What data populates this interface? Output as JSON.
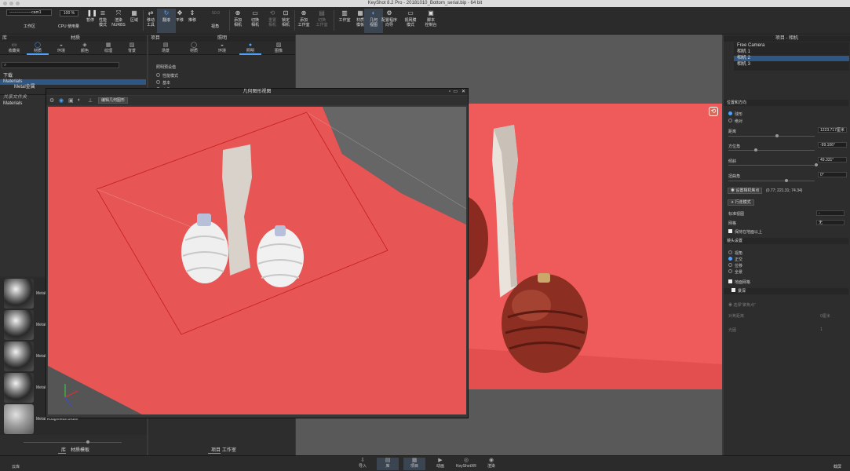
{
  "window": {
    "title": "KeyShot 8.2 Pro  -  20181010_Bottom_serial.bip  -  64 bit"
  },
  "toolbar": {
    "camera_select": "-----------------cam1",
    "workspace": "工作区",
    "cpu_value": "100 %",
    "cpu_label": "CPU 使用量",
    "pause": "暂停",
    "perf_mode": "性能\n模式",
    "render_nurbs": "渲染\nNURBS",
    "region": "区域",
    "move_tool": "移动\n工具",
    "tumble": "翻滚",
    "pan": "平移",
    "dolly": "推移",
    "fov_value": "50.0",
    "view_angle": "视角",
    "add_camera": "添加\n相机",
    "switch_camera": "切换\n相机",
    "reset_camera": "重置\n相机",
    "lock_camera": "锁定\n相机",
    "add_studio": "添加\n工作室",
    "switch_studio": "切换\n工作室",
    "studio": "工作室",
    "material_template": "材质\n模板",
    "geometry_view": "几何\n视图",
    "config_wizard": "配置程序\n向导",
    "viewset_mode": "视网膜\n模式",
    "script_console": "脚本\n控制台"
  },
  "left_panel": {
    "header_lib": "库",
    "header_materials": "材质",
    "tabs": [
      "收藏夹",
      "材质",
      "环境",
      "颜色",
      "纹理",
      "背景"
    ],
    "tree": [
      "下载",
      "Materials",
      "Metal金属"
    ],
    "shared_folder": "共享文件夹",
    "shared_tree": [
      "Materials"
    ],
    "thumb_labels": [
      "Metal",
      "Metal",
      "Metal",
      "Metal",
      "Metal Roughness Brush"
    ],
    "bottom_tabs": [
      "库",
      "材质模板"
    ]
  },
  "project_panel": {
    "header_project": "项目",
    "header_lighting": "照明",
    "tabs": [
      "场景",
      "材质",
      "环境",
      "照明",
      "图像"
    ],
    "preset_title": "照明预设值",
    "presets": [
      "性能模式",
      "基本",
      "产品"
    ],
    "bottom_tabs": [
      "项目",
      "工作室"
    ]
  },
  "geometry_dialog": {
    "title": "几何图形视图",
    "edit_button": "编辑几何图形"
  },
  "right_panel": {
    "header": "项目 - 相机",
    "cameras": [
      "Free Camera",
      "相机 1",
      "相机 2",
      "相机 3"
    ],
    "section_position": "位置和方向",
    "mode_options": [
      "球形",
      "绝对"
    ],
    "distance_label": "距离",
    "distance_value": "1223.717厘米",
    "azimuth_label": "方位角",
    "azimuth_value": "-99.106°",
    "inclination_label": "倾斜",
    "inclination_value": "49.331°",
    "twist_label": "扭曲角",
    "twist_value": "0°",
    "focus_button": "设置相机焦点",
    "focus_coords": "(0.77; 221.31; 74.34)",
    "walk_button": "行走模式",
    "std_view_label": "标准视图",
    "std_view_value": "-",
    "grid_label": "网格",
    "grid_value": "无",
    "keep_above": "保持在地面以上",
    "section_lens": "镜头设置",
    "lens_options": [
      "视角",
      "正交",
      "位移",
      "全景"
    ],
    "ground_grid": "地面网格",
    "section_dof": "景深",
    "select_focus": "选择\"聚焦点\"",
    "focus_distance_label": "对焦距离",
    "focus_distance_value": "0厘米",
    "aperture_label": "光圈",
    "aperture_value": "1"
  },
  "bottom_bar": {
    "left": "云库",
    "items": [
      "导入",
      "库",
      "项目",
      "动画",
      "KeyShotXR",
      "渲染"
    ],
    "right": "截屏"
  },
  "colors": {
    "accent": "#4aa3ff",
    "scene_red": "#ef5a5a"
  }
}
